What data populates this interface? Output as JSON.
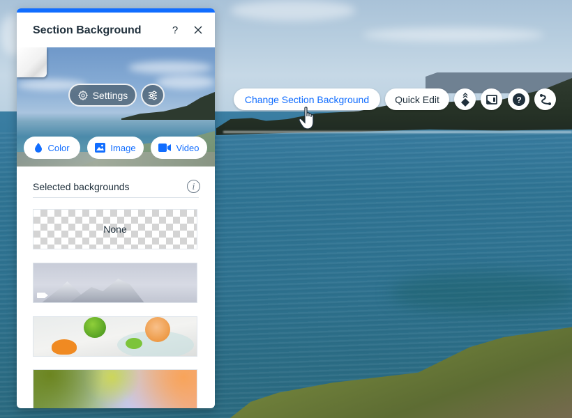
{
  "panel": {
    "title": "Section Background",
    "help_icon": "question-mark-icon",
    "close_icon": "close-icon",
    "accent_color": "#116dff",
    "preview": {
      "settings_label": "Settings",
      "settings_icon": "gear-icon",
      "adjust_icon": "sliders-icon",
      "media_buttons": [
        {
          "label": "Color",
          "icon": "droplet-icon"
        },
        {
          "label": "Image",
          "icon": "image-icon"
        },
        {
          "label": "Video",
          "icon": "video-camera-icon"
        }
      ]
    },
    "selected_backgrounds": {
      "title": "Selected backgrounds",
      "info_icon": "info-icon",
      "items": [
        {
          "type": "none",
          "label": "None"
        },
        {
          "type": "video",
          "description": "Snowy mountain peaks",
          "badge_icon": "video-camera-icon"
        },
        {
          "type": "image",
          "description": "Oranges and limes on marble"
        },
        {
          "type": "gradient",
          "description": "Green to orange gradient"
        }
      ]
    }
  },
  "toolbar": {
    "change_background_label": "Change Section Background",
    "quick_edit_label": "Quick Edit",
    "icon_buttons": [
      {
        "icon": "arrange-layers-icon"
      },
      {
        "icon": "section-layout-icon"
      },
      {
        "icon": "help-circle-icon"
      },
      {
        "icon": "animation-path-icon"
      }
    ]
  }
}
